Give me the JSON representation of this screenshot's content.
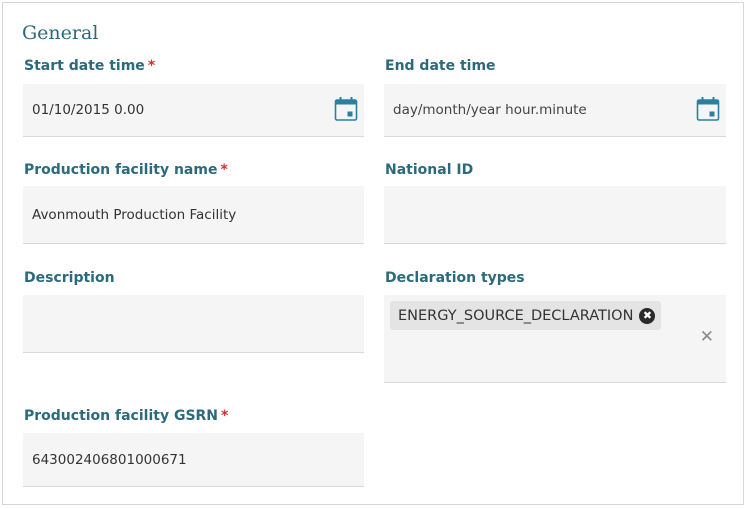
{
  "section": {
    "title": "General"
  },
  "fields": {
    "start_date": {
      "label": "Start date time",
      "required": "*",
      "value": "01/10/2015 0.00",
      "icon": "calendar-icon"
    },
    "end_date": {
      "label": "End date time",
      "placeholder": "day/month/year hour.minute",
      "icon": "calendar-icon"
    },
    "facility_name": {
      "label": "Production facility name",
      "required": "*",
      "value": "Avonmouth Production Facility"
    },
    "national_id": {
      "label": "National ID",
      "value": ""
    },
    "description": {
      "label": "Description",
      "value": ""
    },
    "declaration_types": {
      "label": "Declaration types",
      "chips": [
        {
          "label": "ENERGY_SOURCE_DECLARATION",
          "remove": "✖"
        }
      ],
      "clear": "✕"
    },
    "gsrn": {
      "label": "Production facility GSRN",
      "required": "*",
      "value": "643002406801000671"
    }
  },
  "colors": {
    "accent": "#2b6a7c",
    "required": "#d32f2f",
    "field_bg": "#f5f5f5",
    "chip_bg": "#e4e4e4"
  }
}
